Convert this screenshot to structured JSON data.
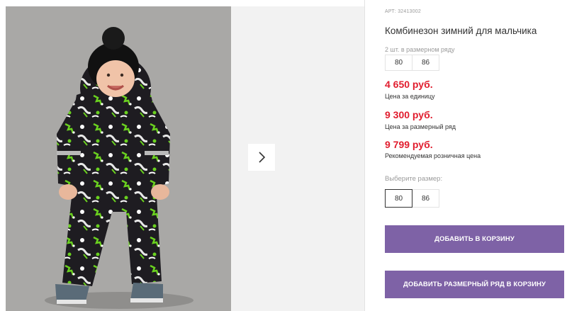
{
  "product": {
    "article": "АРТ: 32413002",
    "title": "Комбинезон зимний для мальчика",
    "pack_note": "2 шт. в размерном ряду",
    "pack_sizes": [
      "80",
      "86"
    ]
  },
  "prices": [
    {
      "value": "4 650 руб.",
      "note": "Цена за единицу"
    },
    {
      "value": "9 300 руб.",
      "note": "Цена за размерный ряд"
    },
    {
      "value": "9 799 руб.",
      "note": "Рекомендуемая розничная цена"
    }
  ],
  "size_select": {
    "label": "Выберите размер:",
    "options": [
      "80",
      "86"
    ],
    "selected": "80"
  },
  "actions": {
    "add_to_cart": "ДОБАВИТЬ В КОРЗИНУ",
    "add_pack_to_cart": "ДОБАВИТЬ РАЗМЕРНЫЙ РЯД В КОРЗИНУ"
  },
  "colors": {
    "price": "#e11d2e",
    "button": "#7e62a6",
    "photo_bg": "#a9a8a6",
    "suit_green": "#6ad11f"
  },
  "gallery": {
    "next_icon": "chevron-right-icon"
  }
}
